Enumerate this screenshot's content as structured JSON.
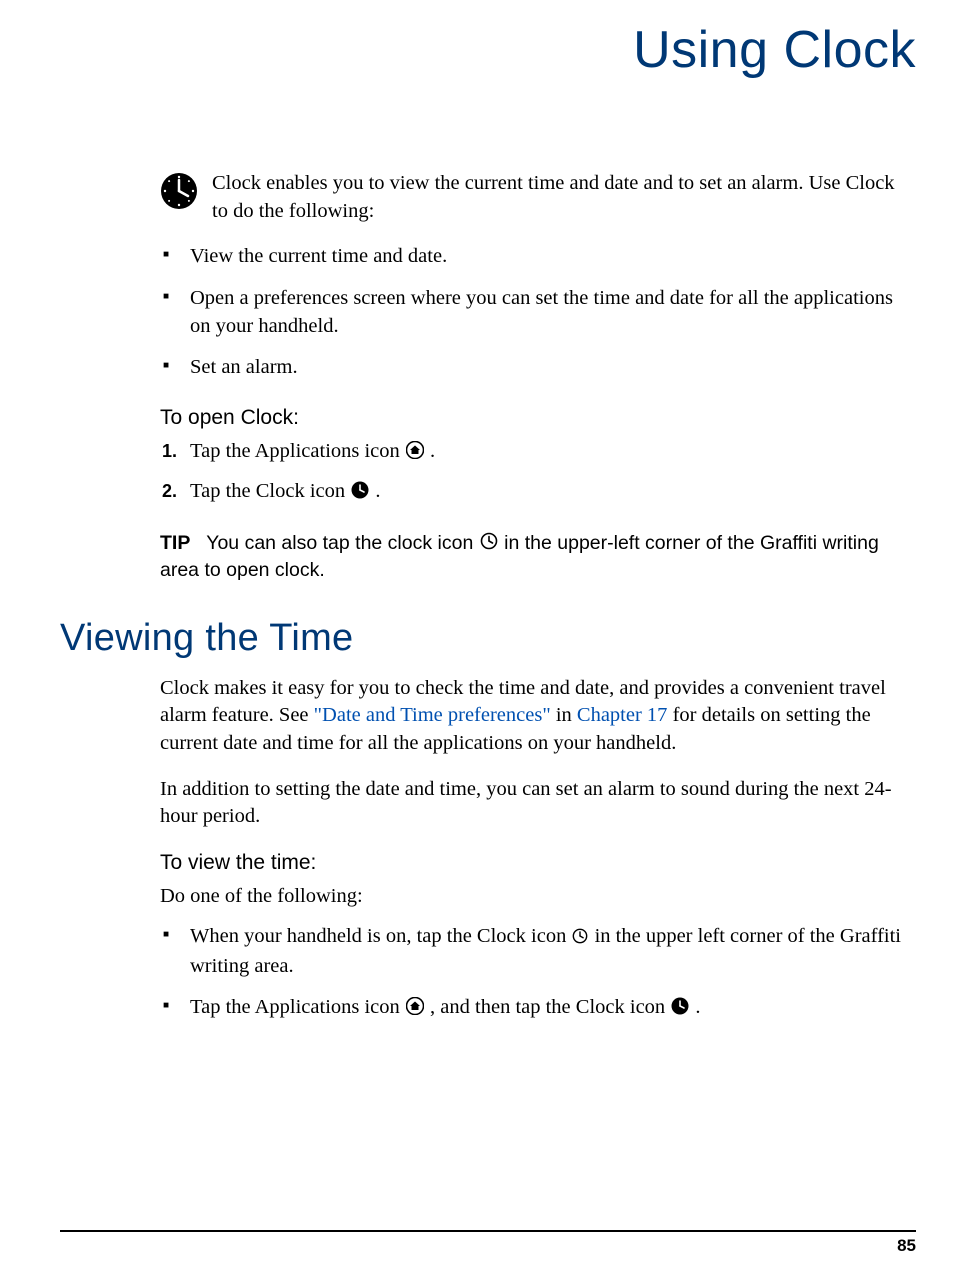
{
  "chapter_title": "Using Clock",
  "intro": "Clock enables you to view the current time and date and to set an alarm. Use Clock to do the following:",
  "bullets_intro": [
    "View the current time and date.",
    "Open a preferences screen where you can set the time and date for all the applications on your handheld.",
    "Set an alarm."
  ],
  "open_clock": {
    "heading": "To open Clock:",
    "step1_a": "Tap the Applications icon ",
    "step1_b": ".",
    "step2_a": "Tap the Clock icon ",
    "step2_b": "."
  },
  "tip": {
    "label": "TIP",
    "text_a": "You can also tap the clock icon ",
    "text_b": " in the upper-left corner of the Graffiti writing area to open clock."
  },
  "section": {
    "heading": "Viewing the Time",
    "para1_a": "Clock makes it easy for you to check the time and date, and provides a convenient travel alarm feature. See ",
    "para1_link1": "\"Date and Time preferences\"",
    "para1_b": " in ",
    "para1_link2": "Chapter 17",
    "para1_c": " for details on setting the current date and time for all the applications on your handheld.",
    "para2": "In addition to setting the date and time, you can set an alarm to sound during the next 24-hour period."
  },
  "view_time": {
    "heading": "To view the time:",
    "lead": "Do one of the following:",
    "b1_a": "When your handheld is on, tap the Clock icon ",
    "b1_b": " in the upper left corner of the Graffiti writing area.",
    "b2_a": "Tap the Applications icon ",
    "b2_b": ", and then tap the Clock icon ",
    "b2_c": "."
  },
  "page_number": "85"
}
